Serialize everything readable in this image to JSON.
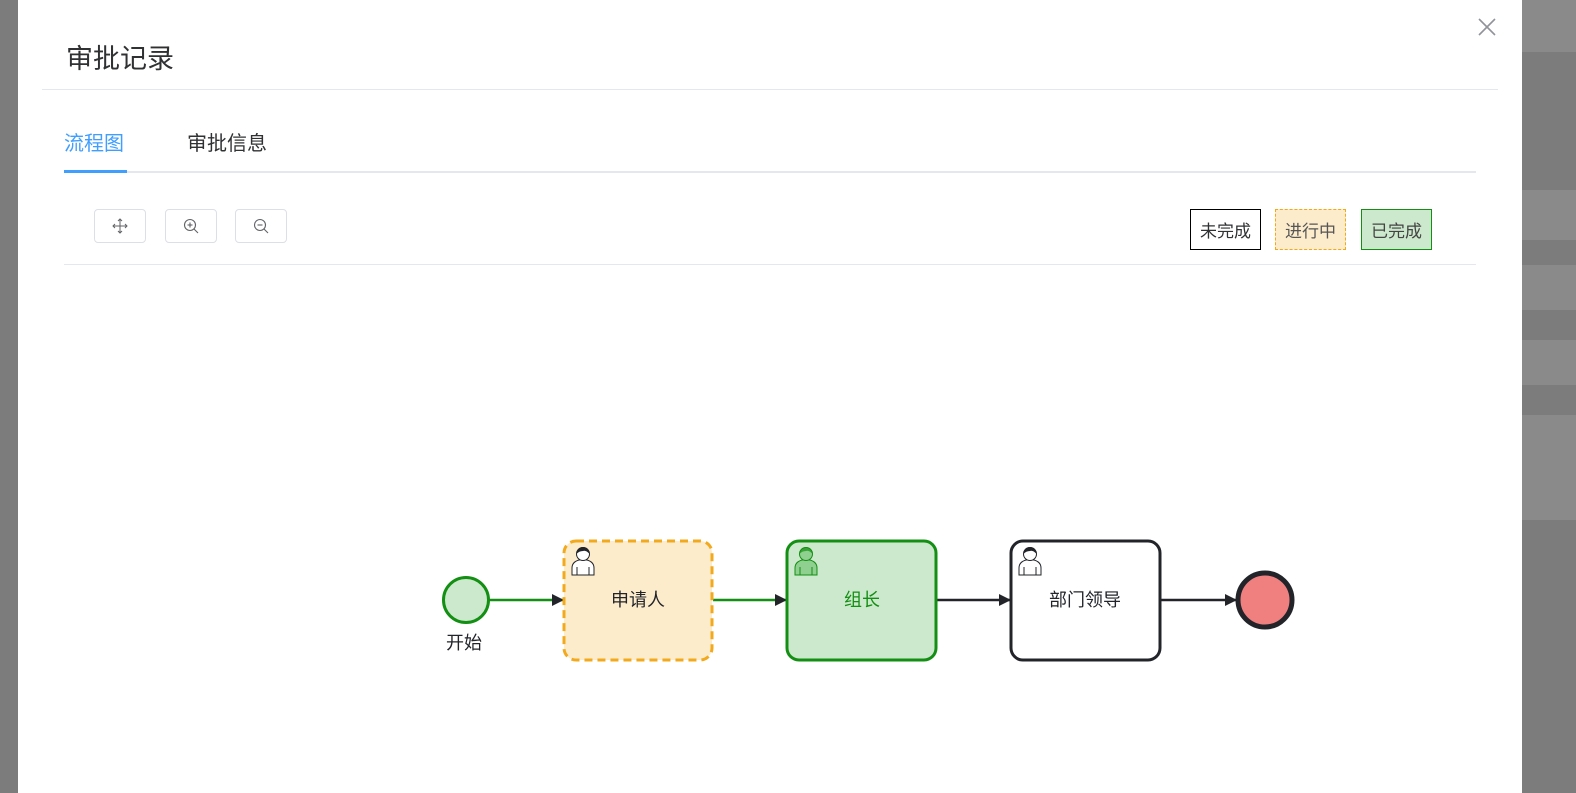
{
  "dialog": {
    "title": "审批记录"
  },
  "tabs": [
    {
      "label": "流程图",
      "active": true
    },
    {
      "label": "审批信息",
      "active": false
    }
  ],
  "toolbar": {
    "buttons": [
      {
        "icon": "move-icon"
      },
      {
        "icon": "zoom-in-icon"
      },
      {
        "icon": "zoom-out-icon"
      }
    ]
  },
  "legend": {
    "pending": "未完成",
    "running": "进行中",
    "done": "已完成"
  },
  "colors": {
    "accent": "#409eff",
    "done_fill": "#cde9cd",
    "done_stroke": "#138f13",
    "running_fill": "#fdeccc",
    "running_stroke": "#f3a91c",
    "end_fill": "#f08080"
  },
  "flow": {
    "start_label": "开始",
    "tasks": [
      {
        "label": "申请人",
        "status": "running"
      },
      {
        "label": "组长",
        "status": "done"
      },
      {
        "label": "部门领导",
        "status": "pending"
      }
    ]
  }
}
